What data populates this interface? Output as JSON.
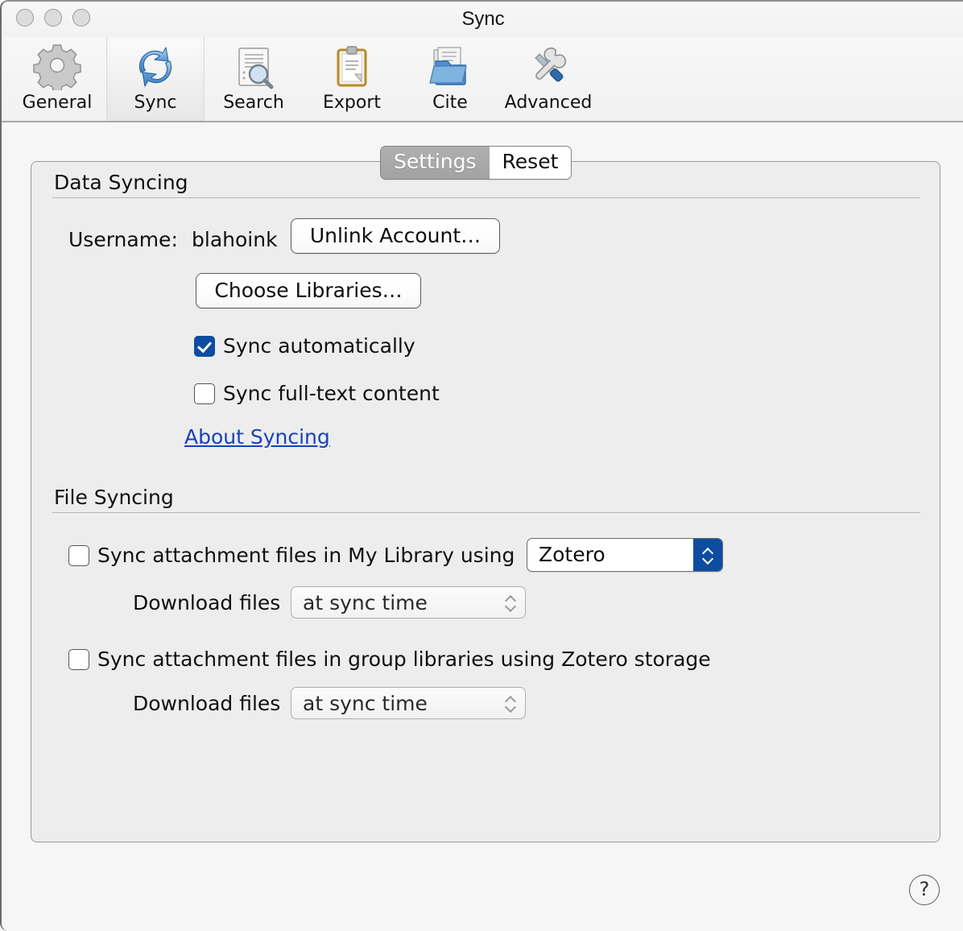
{
  "window": {
    "title": "Sync",
    "traffic_lights": [
      "close",
      "minimize",
      "zoom"
    ]
  },
  "toolbar": {
    "items": [
      {
        "label": "General",
        "icon": "gear-icon",
        "selected": false
      },
      {
        "label": "Sync",
        "icon": "sync-arrows-icon",
        "selected": true
      },
      {
        "label": "Search",
        "icon": "document-search-icon",
        "selected": false
      },
      {
        "label": "Export",
        "icon": "clipboard-icon",
        "selected": false
      },
      {
        "label": "Cite",
        "icon": "folder-documents-icon",
        "selected": false
      },
      {
        "label": "Advanced",
        "icon": "wrench-screwdriver-icon",
        "selected": false
      }
    ]
  },
  "tabs": [
    {
      "label": "Settings",
      "selected": true
    },
    {
      "label": "Reset",
      "selected": false
    }
  ],
  "data_syncing": {
    "heading": "Data Syncing",
    "username_label": "Username:",
    "username_value": "blahoink",
    "unlink_button": "Unlink Account…",
    "choose_libraries_button": "Choose Libraries…",
    "sync_automatically": {
      "label": "Sync automatically",
      "checked": true
    },
    "sync_fulltext": {
      "label": "Sync full-text content",
      "checked": false
    },
    "about_link": "About Syncing"
  },
  "file_syncing": {
    "heading": "File Syncing",
    "my_library": {
      "checkbox_label": "Sync attachment files in My Library using",
      "checked": false,
      "service_value": "Zotero",
      "download_label": "Download files",
      "download_value": "at sync time"
    },
    "group_libraries": {
      "checkbox_label": "Sync attachment files in group libraries using Zotero storage",
      "checked": false,
      "download_label": "Download files",
      "download_value": "at sync time"
    }
  },
  "help": {
    "glyph": "?"
  },
  "colors": {
    "accent_blue": "#0c4da2",
    "link_blue": "#1b41b8",
    "tab_selected_gray": "#a8a8a8",
    "panel_bg": "#ededed",
    "window_bg": "#f6f6f6"
  }
}
